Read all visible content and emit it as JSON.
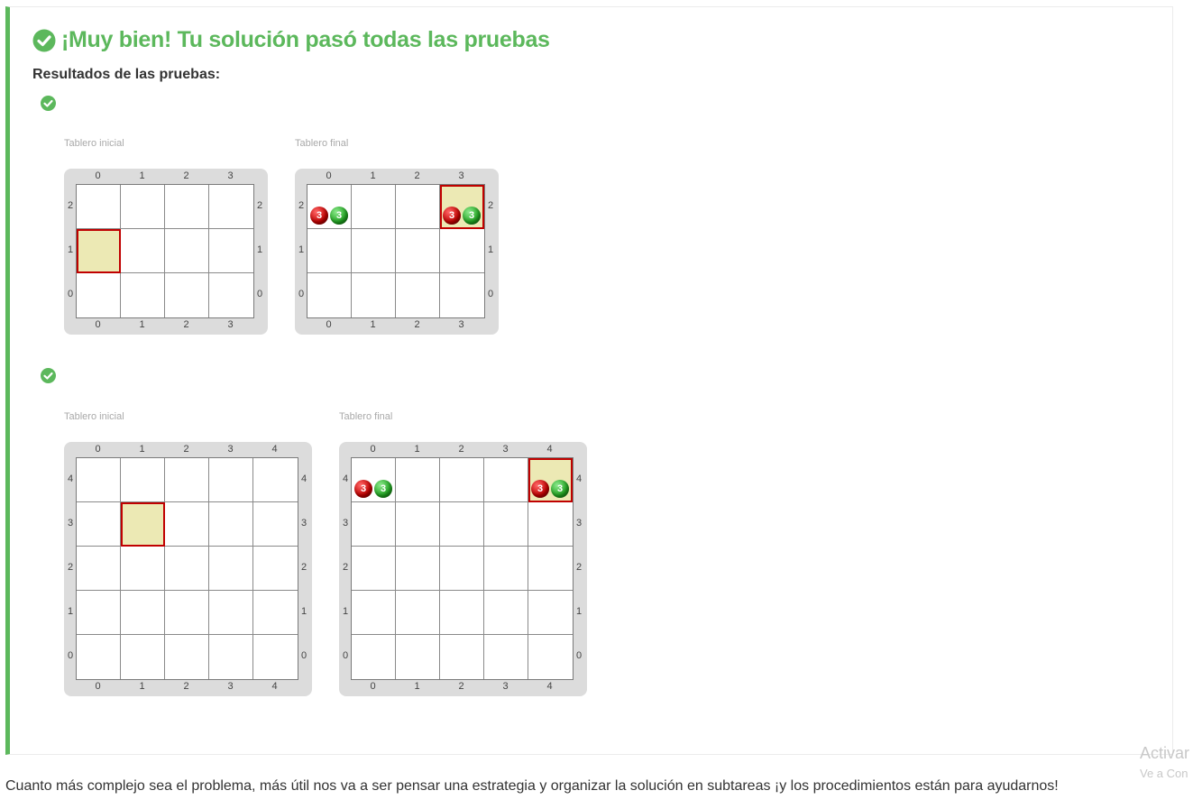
{
  "result": {
    "title": "¡Muy bien! Tu solución pasó todas las pruebas",
    "subtitle": "Resultados de las pruebas:",
    "accent_color": "#5cb85c"
  },
  "tests": [
    {
      "status_icon": "check-circle-icon",
      "initial": {
        "label": "Tablero inicial",
        "cols": 4,
        "rows": 3,
        "col_labels": [
          "0",
          "1",
          "2",
          "3"
        ],
        "row_labels": [
          "2",
          "1",
          "0"
        ],
        "head": {
          "col": 0,
          "row": 1
        },
        "balls": []
      },
      "final": {
        "label": "Tablero final",
        "cols": 4,
        "rows": 3,
        "col_labels": [
          "0",
          "1",
          "2",
          "3"
        ],
        "row_labels": [
          "2",
          "1",
          "0"
        ],
        "head": {
          "col": 3,
          "row": 2
        },
        "balls": [
          {
            "col": 0,
            "row": 2,
            "items": [
              {
                "color": "red",
                "count": "3"
              },
              {
                "color": "green",
                "count": "3"
              }
            ]
          },
          {
            "col": 3,
            "row": 2,
            "items": [
              {
                "color": "red",
                "count": "3"
              },
              {
                "color": "green",
                "count": "3"
              }
            ]
          }
        ]
      }
    },
    {
      "status_icon": "check-circle-icon",
      "initial": {
        "label": "Tablero inicial",
        "cols": 5,
        "rows": 5,
        "col_labels": [
          "0",
          "1",
          "2",
          "3",
          "4"
        ],
        "row_labels": [
          "4",
          "3",
          "2",
          "1",
          "0"
        ],
        "head": {
          "col": 1,
          "row": 3
        },
        "balls": []
      },
      "final": {
        "label": "Tablero final",
        "cols": 5,
        "rows": 5,
        "col_labels": [
          "0",
          "1",
          "2",
          "3",
          "4"
        ],
        "row_labels": [
          "4",
          "3",
          "2",
          "1",
          "0"
        ],
        "head": {
          "col": 4,
          "row": 4
        },
        "balls": [
          {
            "col": 0,
            "row": 4,
            "items": [
              {
                "color": "red",
                "count": "3"
              },
              {
                "color": "green",
                "count": "3"
              }
            ]
          },
          {
            "col": 4,
            "row": 4,
            "items": [
              {
                "color": "red",
                "count": "3"
              },
              {
                "color": "green",
                "count": "3"
              }
            ]
          }
        ]
      }
    }
  ],
  "footer": {
    "text": "Cuanto más complejo sea el problema, más útil nos va a ser pensar una estrategia y organizar la solución en subtareas ¡y los procedimientos están para ayudarnos!"
  },
  "watermark": {
    "line1": "Activar",
    "line2": "Ve a Con"
  }
}
